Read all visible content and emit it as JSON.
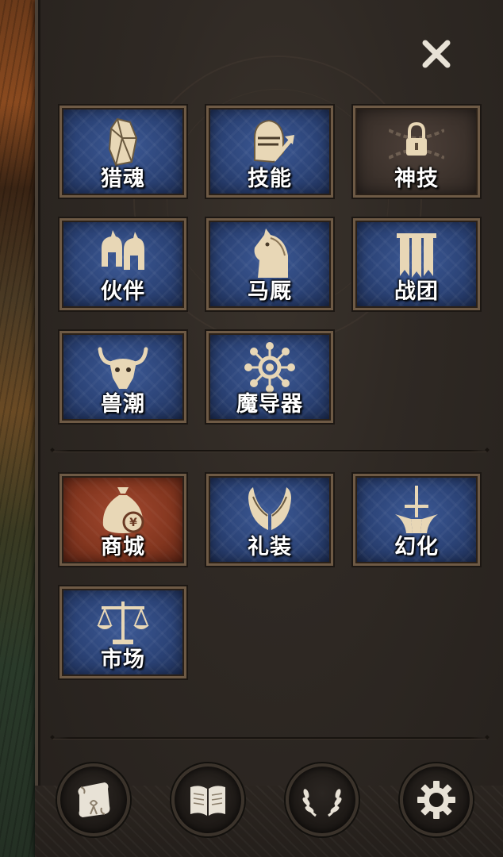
{
  "close": {
    "icon": "close-icon"
  },
  "features": [
    {
      "label": "猎魂",
      "icon": "crystal-icon",
      "style": "blue"
    },
    {
      "label": "技能",
      "icon": "knight-helmet-icon",
      "style": "blue"
    },
    {
      "label": "神技",
      "icon": "lock-icon",
      "style": "locked"
    },
    {
      "label": "伙伴",
      "icon": "spartan-helmet-icon",
      "style": "blue"
    },
    {
      "label": "马厩",
      "icon": "horse-head-icon",
      "style": "blue"
    },
    {
      "label": "战团",
      "icon": "banner-icon",
      "style": "blue"
    },
    {
      "label": "兽潮",
      "icon": "bull-skull-icon",
      "style": "blue"
    },
    {
      "label": "魔导器",
      "icon": "gear-network-icon",
      "style": "blue"
    }
  ],
  "shop_features": [
    {
      "label": "商城",
      "icon": "money-bag-icon",
      "style": "red"
    },
    {
      "label": "礼装",
      "icon": "wings-icon",
      "style": "blue"
    },
    {
      "label": "幻化",
      "icon": "sword-emblem-icon",
      "style": "blue"
    },
    {
      "label": "市场",
      "icon": "scales-icon",
      "style": "blue"
    }
  ],
  "bottom_buttons": [
    {
      "icon": "scroll-icon"
    },
    {
      "icon": "book-icon"
    },
    {
      "icon": "laurel-wreath-icon"
    },
    {
      "icon": "settings-gear-icon"
    }
  ],
  "colors": {
    "icon_gold": "#e8d7b6",
    "tile_blue": "#2c4478",
    "tile_red": "#83361f",
    "tile_locked": "#3c322c"
  }
}
